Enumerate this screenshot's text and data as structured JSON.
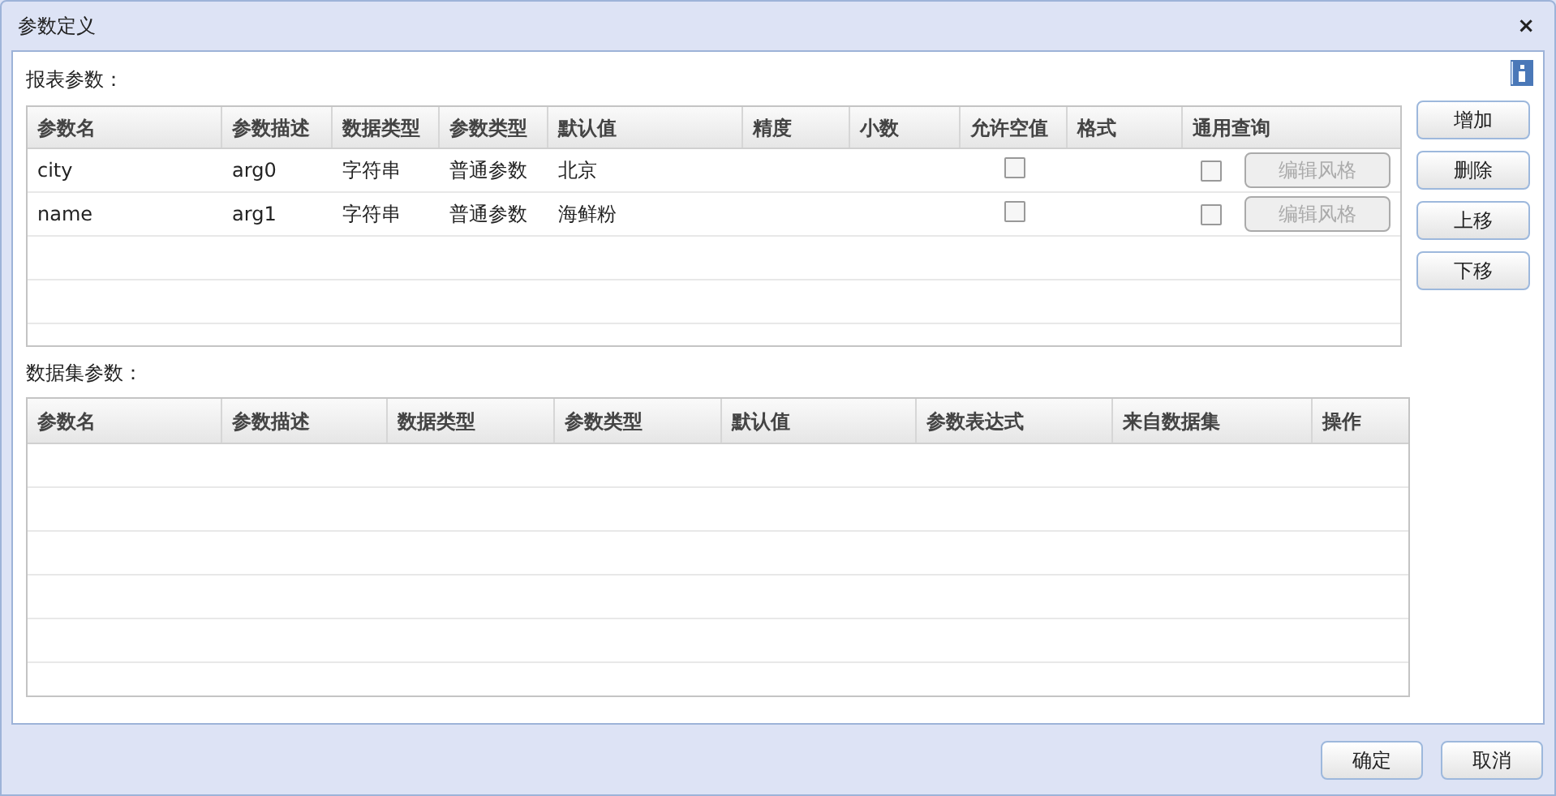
{
  "window": {
    "title": "参数定义",
    "close": "×"
  },
  "report_params": {
    "label": "报表参数：",
    "columns": [
      "参数名",
      "参数描述",
      "数据类型",
      "参数类型",
      "默认值",
      "精度",
      "小数",
      "允许空值",
      "格式",
      "通用查询"
    ],
    "rows": [
      {
        "name": "city",
        "description": "arg0",
        "data_type": "字符串",
        "param_type": "普通参数",
        "default": "北京",
        "allow_null": false,
        "general_query": false,
        "style_button": {
          "label": "编辑风格",
          "disabled": true
        }
      },
      {
        "name": "name",
        "description": "arg1",
        "data_type": "字符串",
        "param_type": "普通参数",
        "default": "海鲜粉",
        "allow_null": false,
        "general_query": false,
        "style_button": {
          "label": "编辑风格",
          "disabled": true
        }
      }
    ]
  },
  "side_buttons": [
    "增加",
    "删除",
    "上移",
    "下移"
  ],
  "dataset_params": {
    "label": "数据集参数：",
    "columns": [
      "参数名",
      "参数描述",
      "数据类型",
      "参数类型",
      "默认值",
      "参数表达式",
      "来自数据集",
      "操作"
    ]
  },
  "footer_buttons": [
    "确定",
    "取消"
  ]
}
